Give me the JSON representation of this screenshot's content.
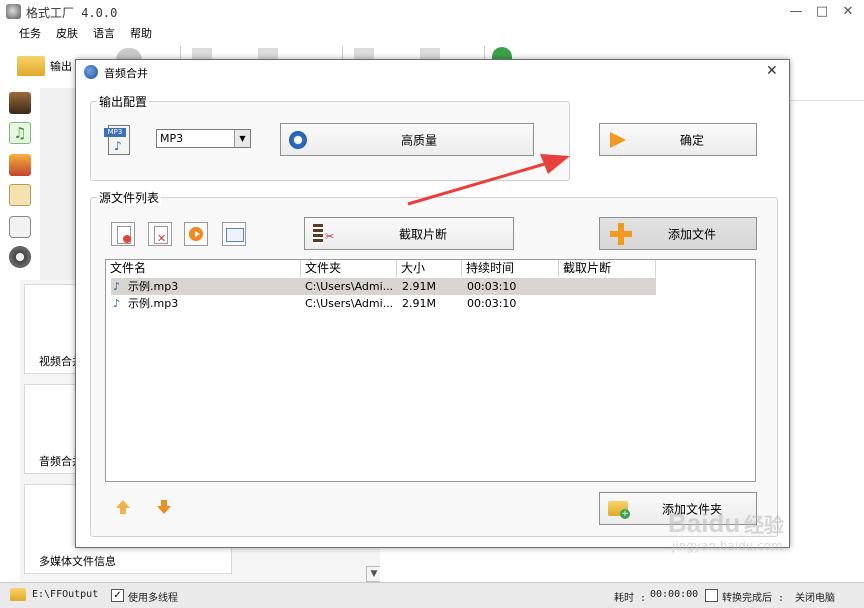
{
  "app": {
    "title": "格式工厂 4.0.0",
    "window_controls": {
      "minimize": "—",
      "maximize": "□",
      "close": "✕"
    }
  },
  "menu": [
    "任务",
    "皮肤",
    "语言",
    "帮助"
  ],
  "toolbar": {
    "output_label": "输出"
  },
  "tiles": [
    {
      "label": "视频合并"
    },
    {
      "label": "音频合并"
    },
    {
      "label": "多媒体文件信息"
    }
  ],
  "scroll": {
    "down": "▼"
  },
  "status": {
    "path": "E:\\FFOutput",
    "multithread_label": "使用多线程",
    "multithread_checked": "✓",
    "elapsed_label": "耗时 :",
    "elapsed_value": "00:00:00",
    "after_label": "转换完成后 :",
    "after_value": "关闭电脑"
  },
  "dialog": {
    "title": "音频合并",
    "close": "✕",
    "output_group": {
      "label": "输出配置",
      "format_value": "MP3",
      "format_icon_text": "MP3",
      "quality_label": "高质量",
      "confirm_label": "确定"
    },
    "source_group": {
      "label": "源文件列表",
      "clip_label": "截取片断",
      "add_file_label": "添加文件",
      "add_folder_label": "添加文件夹"
    },
    "file_table": {
      "columns": [
        "文件名",
        "文件夹",
        "大小",
        "持续时间",
        "截取片断"
      ],
      "rows": [
        {
          "name": "示例.mp3",
          "folder": "C:\\Users\\Admi...",
          "size": "2.91M",
          "duration": "00:03:10",
          "clip": "",
          "selected": true
        },
        {
          "name": "示例.mp3",
          "folder": "C:\\Users\\Admi...",
          "size": "2.91M",
          "duration": "00:03:10",
          "clip": "",
          "selected": false
        }
      ]
    }
  },
  "watermark": {
    "brand": "Baidu",
    "cn": "经验",
    "url": "jingyan.baidu.com"
  },
  "colors": {
    "accent_arrow": "#e8413c",
    "selected_row": "#d8d5d0",
    "add_orange": "#f39a1e"
  }
}
